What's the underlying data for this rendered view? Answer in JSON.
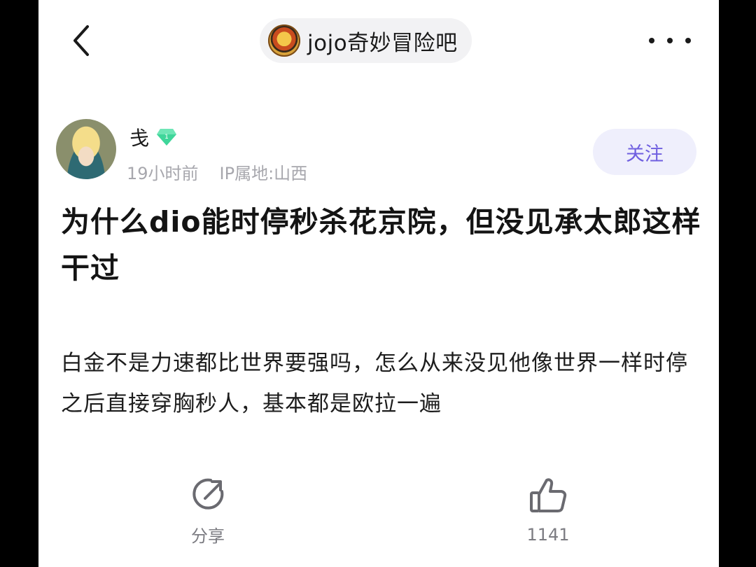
{
  "header": {
    "forum_name": "jojo奇妙冒险吧"
  },
  "author": {
    "name": "戋",
    "level": "1",
    "time": "19小时前",
    "location": "IP属地:山西",
    "follow_label": "关注"
  },
  "post": {
    "title": "为什么dio能时停秒杀花京院，但没见承太郎这样干过",
    "body": "白金不是力速都比世界要强吗，怎么从来没见他像世界一样时停之后直接穿胸秒人，基本都是欧拉一遍"
  },
  "actions": {
    "share_label": "分享",
    "like_count": "1141"
  },
  "colors": {
    "accent": "#6f5fe0",
    "follow_bg": "#efeffc",
    "level_badge": "#3fd69a",
    "meta_text": "#a7a7ad"
  },
  "icons": {
    "back": "chevron-left-icon",
    "more": "more-dots-icon",
    "level": "diamond-level-icon",
    "share": "share-icon",
    "like": "thumbs-up-icon"
  }
}
